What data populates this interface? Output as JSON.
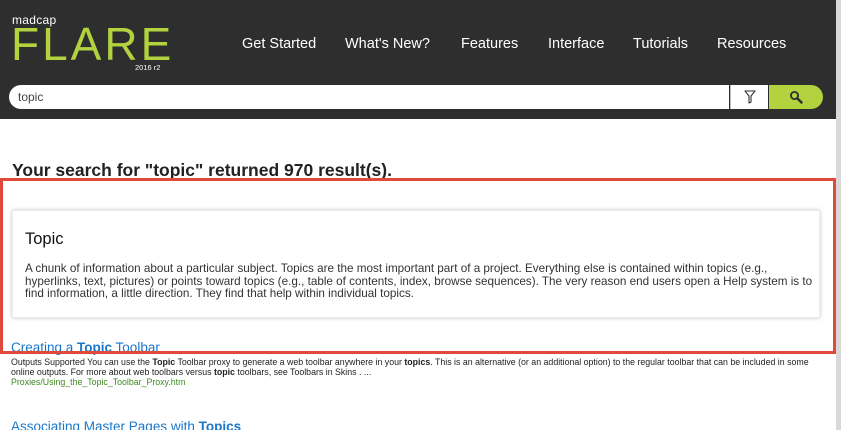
{
  "header": {
    "logo_small": "madcap",
    "logo_big": "FLARE",
    "logo_version": "2016 r2",
    "nav": [
      "Get Started",
      "What's New?",
      "Features",
      "Interface",
      "Tutorials",
      "Resources"
    ]
  },
  "search": {
    "query": "topic"
  },
  "results_heading": "Your search for \"topic\" returned 970 result(s).",
  "glossary": {
    "term": "Topic",
    "definition": "A chunk of information about a particular subject. Topics are the most important part of a project. Everything else is contained within topics (e.g., hyperlinks, text, pictures) or points toward topics (e.g., table of contents, index, browse sequences). The very reason end users open a Help system is to find information, a little direction. They find that help within individual topics."
  },
  "results": [
    {
      "title_pre": "Creating a ",
      "title_hl": "Topic",
      "title_post": " Toolbar",
      "snippet": [
        {
          "t": "Outputs Supported You can use the ",
          "b": false
        },
        {
          "t": "Topic",
          "b": true
        },
        {
          "t": " Toolbar proxy to generate a web toolbar anywhere in your ",
          "b": false
        },
        {
          "t": "topics",
          "b": true
        },
        {
          "t": ". This is an alternative (or an additional option) to the regular toolbar that can be included in some online outputs. For more about web toolbars versus ",
          "b": false
        },
        {
          "t": "topic",
          "b": true
        },
        {
          "t": " toolbars, see Toolbars in Skins . ...",
          "b": false
        }
      ],
      "url": "Proxies/Using_the_Topic_Toolbar_Proxy.htm"
    },
    {
      "title_pre": "Associating Master Pages with ",
      "title_hl": "Topics",
      "title_post": ""
    }
  ],
  "colors": {
    "header_bg": "#2e2e2e",
    "accent_green": "#b2d23e",
    "link_blue": "#1a77c9",
    "url_green": "#3d8a1f",
    "highlight_frame": "#e04a3a"
  },
  "icons": {
    "filter": "filter-icon",
    "search": "search-icon"
  }
}
